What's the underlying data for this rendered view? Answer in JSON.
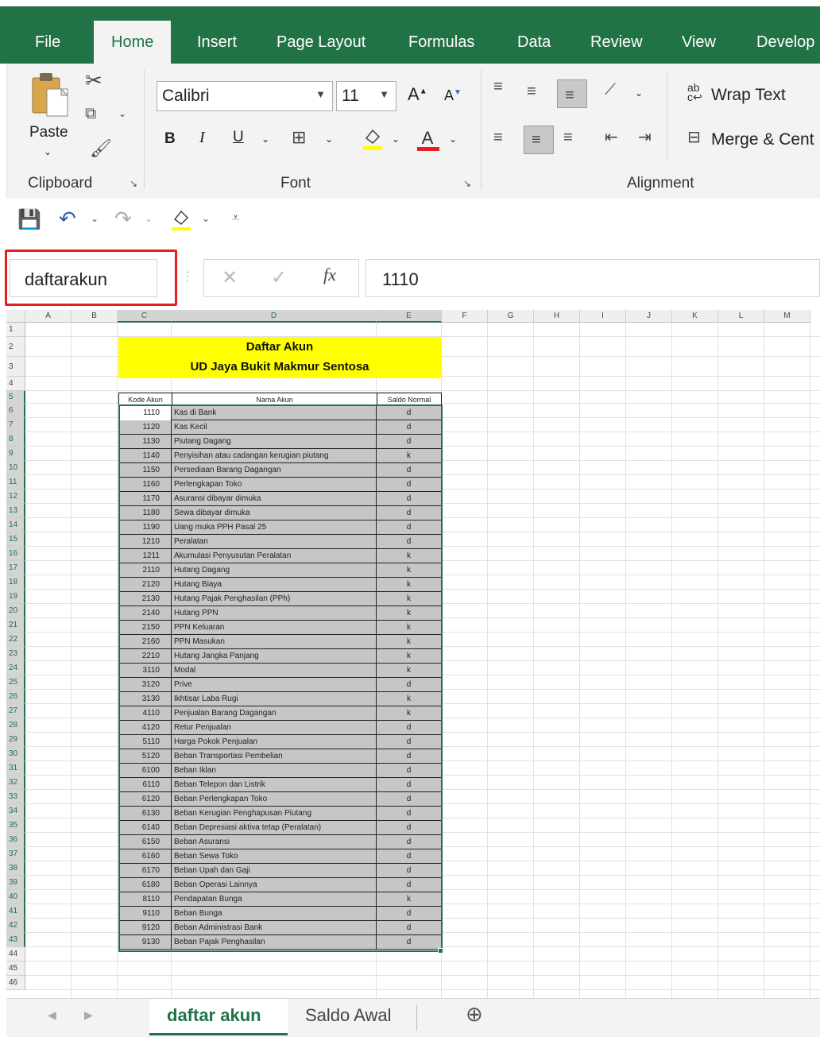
{
  "ribbon_tabs": [
    "File",
    "Home",
    "Insert",
    "Page Layout",
    "Formulas",
    "Data",
    "Review",
    "View",
    "Develop"
  ],
  "active_tab": "Home",
  "clipboard": {
    "paste_label": "Paste",
    "group_label": "Clipboard"
  },
  "font": {
    "name": "Calibri",
    "size": "11",
    "group_label": "Font",
    "bold": "B",
    "italic": "I",
    "underline": "U",
    "font_color_glyph": "A",
    "grow_glyph": "A",
    "shrink_glyph": "A"
  },
  "alignment": {
    "wrap_text": "Wrap Text",
    "merge": "Merge & Cent",
    "group_label": "Alignment"
  },
  "name_box": "daftarakun",
  "formula_bar": {
    "fx_label": "fx",
    "value": "1110"
  },
  "columns": [
    "A",
    "B",
    "C",
    "D",
    "E",
    "F",
    "G",
    "H",
    "I",
    "J",
    "K",
    "L",
    "M"
  ],
  "rows": [
    "1",
    "2",
    "3",
    "4",
    "5",
    "6",
    "7",
    "8",
    "9",
    "10",
    "11",
    "12",
    "13",
    "14",
    "15",
    "16",
    "17",
    "18",
    "19",
    "20",
    "21",
    "22",
    "23",
    "24",
    "25",
    "26",
    "27",
    "28",
    "29",
    "30",
    "31",
    "32",
    "33",
    "34",
    "35",
    "36",
    "37",
    "38",
    "39",
    "40",
    "41",
    "42",
    "43",
    "44",
    "45",
    "46"
  ],
  "sheet": {
    "title": "Daftar Akun",
    "subtitle": "UD Jaya Bukit Makmur Sentosa",
    "headers": [
      "Kode Akun",
      "Nama Akun",
      "Saldo Normal"
    ],
    "accounts": [
      [
        "1110",
        "Kas di Bank",
        "d"
      ],
      [
        "1120",
        "Kas Kecil",
        "d"
      ],
      [
        "1130",
        "Piutang Dagang",
        "d"
      ],
      [
        "1140",
        "Penyisihan atau cadangan kerugian piutang",
        "k"
      ],
      [
        "1150",
        "Persediaan Barang Dagangan",
        "d"
      ],
      [
        "1160",
        "Perlengkapan Toko",
        "d"
      ],
      [
        "1170",
        "Asuransi dibayar dimuka",
        "d"
      ],
      [
        "1180",
        "Sewa dibayar dimuka",
        "d"
      ],
      [
        "1190",
        "Uang muka PPH Pasal 25",
        "d"
      ],
      [
        "1210",
        "Peralatan",
        "d"
      ],
      [
        "1211",
        "Akumulasi Penyusutan Peralatan",
        "k"
      ],
      [
        "2110",
        "Hutang Dagang",
        "k"
      ],
      [
        "2120",
        "Hutang Biaya",
        "k"
      ],
      [
        "2130",
        "Hutang Pajak Penghasilan (PPh)",
        "k"
      ],
      [
        "2140",
        "Hutang PPN",
        "k"
      ],
      [
        "2150",
        "PPN Keluaran",
        "k"
      ],
      [
        "2160",
        "PPN Masukan",
        "k"
      ],
      [
        "2210",
        "Hutang Jangka Panjang",
        "k"
      ],
      [
        "3110",
        "Modal",
        "k"
      ],
      [
        "3120",
        "Prive",
        "d"
      ],
      [
        "3130",
        "Ikhtisar Laba Rugi",
        "k"
      ],
      [
        "4110",
        "Penjualan Barang Dagangan",
        "k"
      ],
      [
        "4120",
        "Retur Penjualan",
        "d"
      ],
      [
        "5110",
        "Harga Pokok Penjualan",
        "d"
      ],
      [
        "5120",
        "Beban Transportasi Pembelian",
        "d"
      ],
      [
        "6100",
        "Beban Iklan",
        "d"
      ],
      [
        "6110",
        "Beban Telepon dan Listrik",
        "d"
      ],
      [
        "6120",
        "Beban Perlengkapan Toko",
        "d"
      ],
      [
        "6130",
        "Beban Kerugian Penghapusan Piutang",
        "d"
      ],
      [
        "6140",
        "Beban Depresiasi aktiva tetap (Peralatan)",
        "d"
      ],
      [
        "6150",
        "Beban Asuransi",
        "d"
      ],
      [
        "6160",
        "Beban Sewa Toko",
        "d"
      ],
      [
        "6170",
        "Beban Upah dan Gaji",
        "d"
      ],
      [
        "6180",
        "Beban Operasi Lainnya",
        "d"
      ],
      [
        "8110",
        "Pendapatan Bunga",
        "k"
      ],
      [
        "9110",
        "Beban Bunga",
        "d"
      ],
      [
        "9120",
        "Beban Administrasi Bank",
        "d"
      ],
      [
        "9130",
        "Beban Pajak Penghasilan",
        "d"
      ]
    ]
  },
  "sheet_tabs": [
    "daftar akun",
    "Saldo Awal"
  ],
  "active_sheet": "daftar akun",
  "colors": {
    "excel_green": "#217346",
    "title_fill": "#ffff00",
    "table_fill": "#c6c6c6",
    "highlight_red": "#e81d23"
  }
}
